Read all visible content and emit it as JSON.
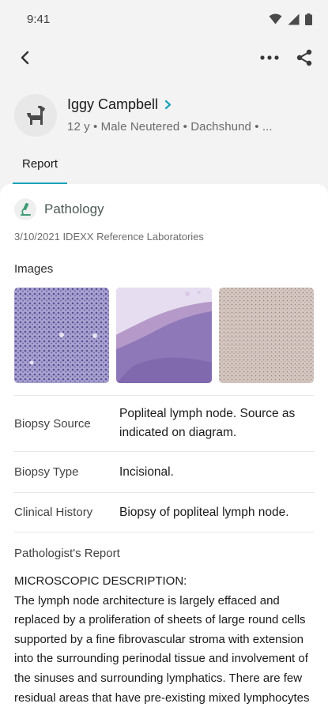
{
  "status_bar": {
    "time": "9:41"
  },
  "top_bar": {
    "back_icon": "back-arrow-icon",
    "more_icon": "more-icon",
    "share_icon": "share-icon"
  },
  "patient": {
    "name": "Iggy Campbell",
    "details": "12 y • Male Neutered • Dachshund • ...",
    "avatar_icon": "dog-icon"
  },
  "tabs": [
    {
      "label": "Report",
      "selected": true
    }
  ],
  "report": {
    "section_title": "Pathology",
    "meta": "3/10/2021 IDEXX Reference Laboratories",
    "images_label": "Images",
    "rows": [
      {
        "label": "Biopsy Source",
        "value": "Popliteal lymph node. Source as indicated on diagram."
      },
      {
        "label": "Biopsy Type",
        "value": "Incisional."
      },
      {
        "label": "Clinical History",
        "value": "Biopsy of popliteal lymph node."
      }
    ],
    "pathologist_label": "Pathologist's Report",
    "description_heading": "MICROSCOPIC DESCRIPTION:",
    "description_text": "The lymph node architecture is largely effaced and replaced by a proliferation of sheets of large round cells supported by a fine fibrovascular stroma with extension into the surrounding perinodal tissue and involvement of the sinuses and surrounding lymphatics. There are few residual areas that have pre-existing mixed lymphocytes including small"
  },
  "colors": {
    "accent": "#1aa3b8",
    "background": "#f3f3f4",
    "card": "#ffffff"
  }
}
